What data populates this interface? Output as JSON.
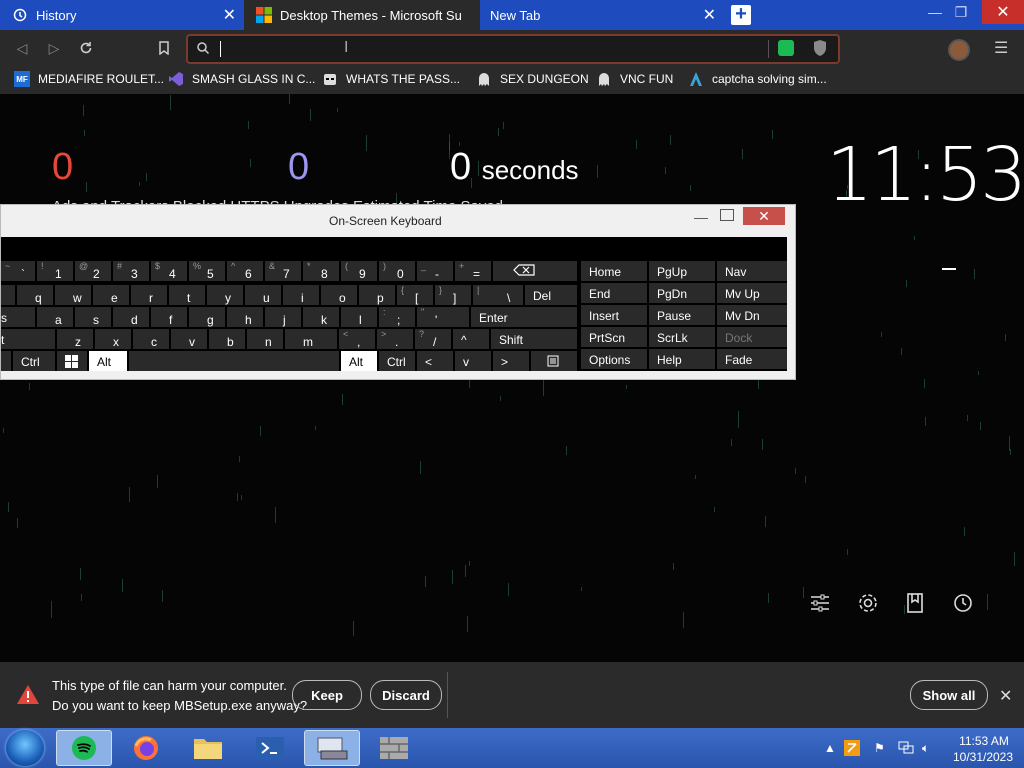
{
  "browser": {
    "tabs": [
      {
        "label": "History",
        "icon": "history-icon"
      },
      {
        "label": "Desktop Themes - Microsoft Supp",
        "icon": "microsoft-logo-icon"
      },
      {
        "label": "New Tab",
        "icon": ""
      }
    ],
    "url_value": "",
    "bookmarks": [
      {
        "label": "MEDIAFIRE ROULET...",
        "icon": "mediafire-icon"
      },
      {
        "label": "SMASH GLASS IN C...",
        "icon": "visual-studio-icon"
      },
      {
        "label": "WHATS THE PASS...",
        "icon": "mask-icon"
      },
      {
        "label": "SEX DUNGEON",
        "icon": "ghost-icon"
      },
      {
        "label": "VNC FUN",
        "icon": "ghost-icon"
      },
      {
        "label": "captcha solving sim...",
        "icon": "arch-icon"
      }
    ]
  },
  "newtab": {
    "stats": [
      {
        "value": "0",
        "color": "#e8483a"
      },
      {
        "value": "0",
        "color": "#9b96ee"
      },
      {
        "value": "0",
        "unit": "seconds",
        "color": "#ffffff"
      }
    ],
    "stat_labels_partial": "Ads and Trackers Blocked   HTTPS Upgrades   Estimated Time Saved",
    "clock": "11:53",
    "corner_tools": [
      "customize-icon",
      "settings-icon",
      "bookmarks-icon",
      "history-icon"
    ]
  },
  "osk": {
    "title": "On-Screen Keyboard",
    "row1": [
      {
        "sub": "~",
        "main": "`"
      },
      {
        "sub": "!",
        "main": "1"
      },
      {
        "sub": "@",
        "main": "2"
      },
      {
        "sub": "#",
        "main": "3"
      },
      {
        "sub": "$",
        "main": "4"
      },
      {
        "sub": "%",
        "main": "5"
      },
      {
        "sub": "^",
        "main": "6"
      },
      {
        "sub": "&",
        "main": "7"
      },
      {
        "sub": "*",
        "main": "8"
      },
      {
        "sub": "(",
        "main": "9"
      },
      {
        "sub": ")",
        "main": "0"
      },
      {
        "sub": "_",
        "main": "-"
      },
      {
        "sub": "+",
        "main": "="
      }
    ],
    "row2": [
      "q",
      "w",
      "e",
      "r",
      "t",
      "y",
      "u",
      "i",
      "o",
      "p"
    ],
    "row2_extra": [
      {
        "sub": "{",
        "main": "["
      },
      {
        "sub": "}",
        "main": "]"
      },
      {
        "sub": "|",
        "main": "\\"
      }
    ],
    "del": "Del",
    "row3_first": "s",
    "row3": [
      "a",
      "s",
      "d",
      "f",
      "g",
      "h",
      "j",
      "k",
      "l"
    ],
    "row3_extra": [
      {
        "sub": ":",
        "main": ";"
      },
      {
        "sub": "\"",
        "main": "'"
      }
    ],
    "enter": "Enter",
    "row4_first": "t",
    "row4": [
      "z",
      "x",
      "c",
      "v",
      "b",
      "n",
      "m"
    ],
    "row4_extra": [
      {
        "sub": "<",
        "main": ","
      },
      {
        "sub": ">",
        "main": "."
      },
      {
        "sub": "?",
        "main": "/"
      }
    ],
    "up": "^",
    "shift": "Shift",
    "ctrl": "Ctrl",
    "alt": "Alt",
    "left": "<",
    "down": "v",
    "right": ">",
    "nav_keys": [
      [
        "Home",
        "PgUp",
        "Nav"
      ],
      [
        "End",
        "PgDn",
        "Mv Up"
      ],
      [
        "Insert",
        "Pause",
        "Mv Dn"
      ],
      [
        "PrtScn",
        "ScrLk",
        "Dock"
      ],
      [
        "Options",
        "Help",
        "Fade"
      ]
    ]
  },
  "download": {
    "line1": "This type of file can harm your computer.",
    "line2": "Do you want to keep MBSetup.exe anyway?",
    "keep": "Keep",
    "discard": "Discard",
    "show_all": "Show all"
  },
  "taskbar": {
    "apps": [
      "spotify-icon",
      "firefox-icon",
      "file-explorer-icon",
      "powershell-icon",
      "on-screen-keyboard-icon",
      "firewall-icon"
    ],
    "time": "11:53 AM",
    "date": "10/31/2023"
  }
}
